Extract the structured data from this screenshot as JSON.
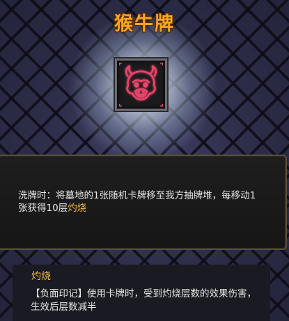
{
  "card": {
    "title": "猴牛牌",
    "icon": "monkey-bull-face-icon",
    "description_prefix": "洗牌时：将墓地的1张随机卡牌移至我方抽牌堆，每移动1张获得10层",
    "description_keyword": "灼烧"
  },
  "keyword": {
    "name": "灼烧",
    "description": "【负面印记】使用卡牌时，受到灼烧层数的效果伤害，生效后层数减半"
  },
  "colors": {
    "title": "#f5a623",
    "keyword": "#f5b942",
    "icon_glow": "#e8456a"
  }
}
